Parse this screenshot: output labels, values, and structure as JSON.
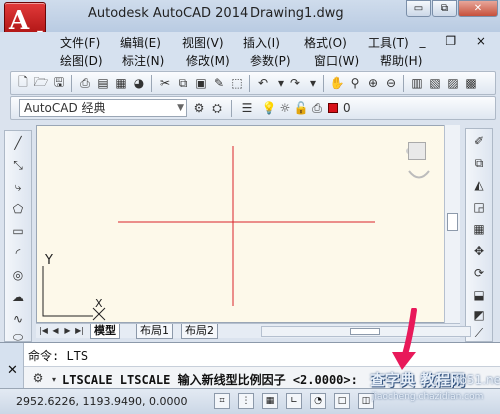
{
  "window": {
    "app_title": "Autodesk AutoCAD 2014",
    "doc_title": "Drawing1.dwg",
    "minimize": "▭",
    "restore": "⧉",
    "close": "✕",
    "app_button_icon": "autocad-a-logo"
  },
  "menubar": {
    "row1": [
      "文件(F)",
      "编辑(E)",
      "视图(V)",
      "插入(I)",
      "格式(O)",
      "工具(T)"
    ],
    "row2": [
      "绘图(D)",
      "标注(N)",
      "修改(M)",
      "参数(P)",
      "窗口(W)",
      "帮助(H)"
    ],
    "mdi_controls": "_ ❐ ×"
  },
  "workspace": {
    "name": "AutoCAD 经典",
    "layer_name": "0"
  },
  "tabs": [
    "模型",
    "布局1",
    "布局2"
  ],
  "command": {
    "history": "命令: LTS",
    "current": "LTSCALE LTSCALE 输入新线型比例因子 <2.0000>:"
  },
  "status": {
    "coordinates": "2952.6226, 1193.9490, 0.0000"
  },
  "ucs": {
    "y_label": "Y",
    "x_label": "X"
  },
  "watermark": {
    "main": "查字典 教程网",
    "site": "jb51.net",
    "sub": "jiaocheng.chazidian.com"
  },
  "colors": {
    "crosshair": "#d9222a",
    "canvas": "#fdf9ea",
    "annotation_arrow": "#e8195a"
  }
}
